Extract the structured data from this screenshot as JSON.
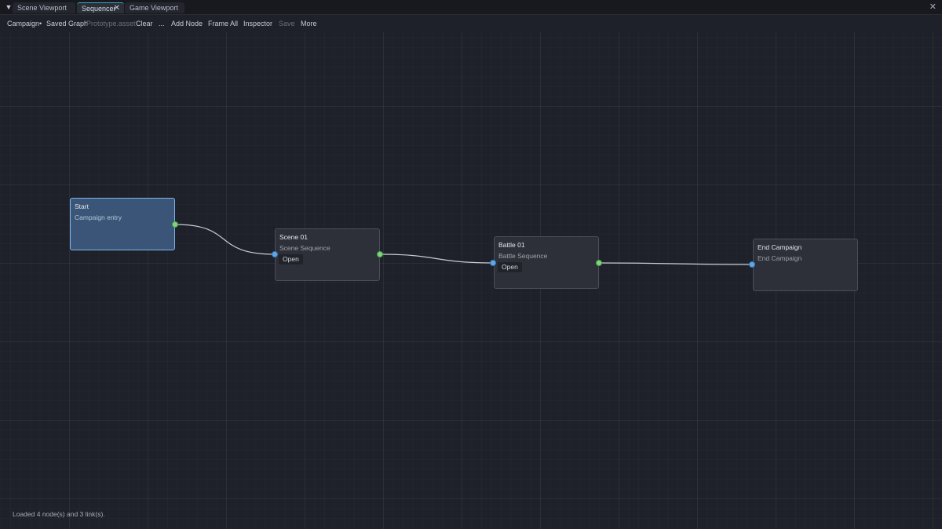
{
  "tabs": [
    {
      "label": "Scene Viewport",
      "active": false
    },
    {
      "label": "Sequencer",
      "active": true
    },
    {
      "label": "Game Viewport",
      "active": false
    }
  ],
  "tab_close_glyph": "✕",
  "menu_glyph": "▼",
  "toolbar": {
    "breadcrumb_root": "Campaign",
    "separator": "•",
    "graph_name": "Saved Graph",
    "asset_name": "Prototype.asset",
    "clear": "Clear",
    "ellipsis": "...",
    "add_node": "Add Node",
    "frame_all": "Frame All",
    "inspector": "Inspector",
    "save": "Save",
    "more": "More"
  },
  "nodes": {
    "start": {
      "title": "Start",
      "subtitle": "Campaign entry",
      "selected": true
    },
    "scene01": {
      "title": "Scene 01",
      "subtitle": "Scene Sequence",
      "action": "Open"
    },
    "battle01": {
      "title": "Battle 01",
      "subtitle": "Battle Sequence",
      "action": "Open"
    },
    "end": {
      "title": "End Campaign",
      "subtitle": "End Campaign"
    }
  },
  "status": "Loaded 4 node(s) and 3 link(s).",
  "colors": {
    "accent_tab": "#3aa0c8",
    "selected_node": "#3a5577",
    "output_port": "#7cd67a",
    "input_port": "#5fa8e8",
    "link": "#c8cbd1"
  }
}
